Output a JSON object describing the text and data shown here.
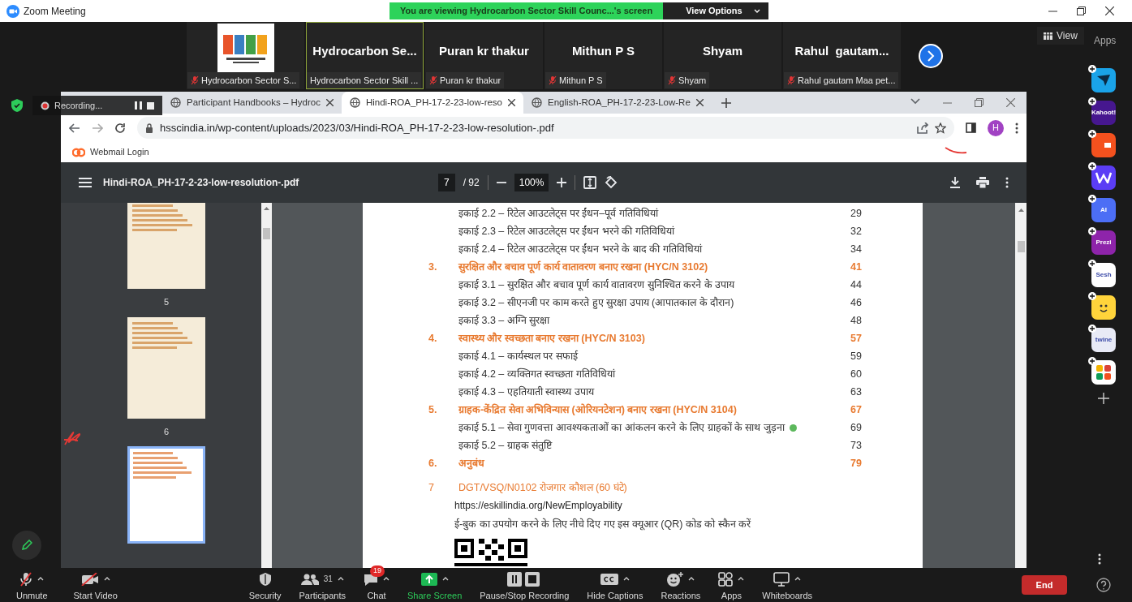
{
  "window": {
    "title": "Zoom Meeting"
  },
  "share_banner": {
    "text": "You are viewing Hydrocarbon Sector Skill Counc...'s screen",
    "view_options": "View Options"
  },
  "participants": [
    {
      "kind": "logo",
      "label": "Hydrocarbon Sector S...",
      "muted": true,
      "speaking": false
    },
    {
      "kind": "name",
      "name": "Hydrocarbon Se...",
      "label": "Hydrocarbon Sector Skill ...",
      "muted": false,
      "speaking": true
    },
    {
      "kind": "name",
      "name": "Puran kr thakur",
      "label": "Puran kr thakur",
      "muted": true,
      "speaking": false
    },
    {
      "kind": "name",
      "name": "Mithun P S",
      "label": "Mithun P S",
      "muted": true,
      "speaking": false
    },
    {
      "kind": "name",
      "name": "Shyam",
      "label": "Shyam",
      "muted": true,
      "speaking": false
    },
    {
      "kind": "name",
      "name": "Rahul  gautam...",
      "label": "Rahul gautam Maa pet...",
      "muted": true,
      "speaking": false
    }
  ],
  "view_button": "View",
  "apps_label": "Apps",
  "apps": [
    {
      "kind": "arrow",
      "color": "#1aa3e8"
    },
    {
      "kind": "text",
      "label": "Kahoot!",
      "color": "#46178f"
    },
    {
      "kind": "shape",
      "color": "#f4511e"
    },
    {
      "kind": "w",
      "color": "#5b3df5"
    },
    {
      "kind": "text",
      "label": "AI",
      "color": "#4c6ef5"
    },
    {
      "kind": "text",
      "label": "Prezi",
      "color": "#8e24aa"
    },
    {
      "kind": "text",
      "label": "Sesh",
      "color": "#ffffff"
    },
    {
      "kind": "face",
      "color": "#ffd43b"
    },
    {
      "kind": "text",
      "label": "twine",
      "color": "#e8eaf6"
    },
    {
      "kind": "grid",
      "color": "#ffffff"
    }
  ],
  "recording": {
    "text": "Recording..."
  },
  "browser": {
    "tabs": [
      {
        "title": "Participant Handbooks – Hydroc",
        "selected": false
      },
      {
        "title": "Hindi-ROA_PH-17-2-23-low-reso",
        "selected": true
      },
      {
        "title": "English-ROA_PH-17-2-23-Low-Re",
        "selected": false
      }
    ],
    "url": "hsscindia.in/wp-content/uploads/2023/03/Hindi-ROA_PH-17-2-23-low-resolution-.pdf",
    "profile_initial": "H",
    "bookmarks": [
      "Webmail Login"
    ]
  },
  "pdf": {
    "filename": "Hindi-ROA_PH-17-2-23-low-resolution-.pdf",
    "page": "7",
    "total": "/ 92",
    "zoom": "100%",
    "thumbnails": [
      {
        "label": "5",
        "selected": false
      },
      {
        "label": "6",
        "selected": false
      },
      {
        "selected": true
      }
    ],
    "toc": [
      {
        "kind": "unit",
        "text": "इकाई 2.2 – रिटेल आउटलेट्स पर ईंधन–पूर्व गतिविधियां",
        "page": "29"
      },
      {
        "kind": "unit",
        "text": "इकाई 2.3 – रिटेल आउटलेट्स पर ईंधन भरने की गतिविधियां",
        "page": "32"
      },
      {
        "kind": "unit",
        "text": "इकाई 2.4 – रिटेल आउटलेट्स पर ईंधन भरने के बाद की गतिविधियां",
        "page": "34"
      },
      {
        "kind": "section",
        "number": "3.",
        "text": "सुरक्षित और बचाव पूर्ण कार्य वातावरण बनाए रखना (HYC/N 3102)",
        "page": "41"
      },
      {
        "kind": "unit",
        "text": "इकाई 3.1 – सुरक्षित और बचाव पूर्ण कार्य वातावरण सुनिश्चित करने के उपाय",
        "page": "44"
      },
      {
        "kind": "unit",
        "text": "इकाई 3.2 – सीएनजी पर काम करते हुए सुरक्षा उपाय (आपातकाल के दौरान)",
        "page": "46"
      },
      {
        "kind": "unit",
        "text": "इकाई 3.3 – अग्नि सुरक्षा",
        "page": "48"
      },
      {
        "kind": "section",
        "number": "4.",
        "text": "स्वास्थ्य और स्वच्छता बनाए रखना (HYC/N 3103)",
        "page": "57"
      },
      {
        "kind": "unit",
        "text": "इकाई 4.1 – कार्यस्थल पर सफाई",
        "page": "59"
      },
      {
        "kind": "unit",
        "text": "इकाई 4.2 – व्यक्तिगत स्वच्छता गतिविधियां",
        "page": "60"
      },
      {
        "kind": "unit",
        "text": "इकाई 4.3 – एहतियाती स्वास्थ्य उपाय",
        "page": "63"
      },
      {
        "kind": "section",
        "number": "5.",
        "text": "ग्राहक-केंद्रित सेवा अभिविन्यास (ओरियनटेशन) बनाए रखना (HYC/N 3104)",
        "page": "67"
      },
      {
        "kind": "unit",
        "text": "इकाई 5.1 – सेवा गुणवत्ता आवश्यकताओं का आंकलन करने के लिए ग्राहकों के साथ जुड़ना",
        "page": "69",
        "annotated": true
      },
      {
        "kind": "unit",
        "text": "इकाई 5.2 – ग्राहक संतुष्टि",
        "page": "73"
      },
      {
        "kind": "section",
        "number": "6.",
        "text": "अनुबंध",
        "page": "79"
      }
    ],
    "footer": {
      "number": "7",
      "heading": "DGT/VSQ/N0102 रोजगार कौशल (60 घंटे)",
      "link": "https://eskillindia.org/NewEmployability",
      "instruction": "ई-बुक का उपयोग करने के लिए नीचे दिए गए इस क्यूआर (QR) कोड को स्कैन करें"
    }
  },
  "toolbar": {
    "left": [
      {
        "kind": "mic",
        "label": "Unmute",
        "caret": true
      },
      {
        "kind": "video",
        "label": "Start Video",
        "caret": true
      }
    ],
    "center": [
      {
        "kind": "security",
        "label": "Security",
        "caret": false
      },
      {
        "kind": "participants",
        "label": "Participants",
        "count": "31",
        "caret": true
      },
      {
        "kind": "chat",
        "label": "Chat",
        "badge": "19",
        "caret": true
      },
      {
        "kind": "share",
        "label": "Share Screen",
        "caret": true
      },
      {
        "kind": "record",
        "label": "Pause/Stop Recording",
        "caret": false
      },
      {
        "kind": "captions",
        "label": "Hide Captions",
        "caret": true
      },
      {
        "kind": "reactions",
        "label": "Reactions",
        "caret": true
      },
      {
        "kind": "apps",
        "label": "Apps",
        "caret": true
      },
      {
        "kind": "whiteboard",
        "label": "Whiteboards",
        "caret": true
      }
    ],
    "end": "End"
  }
}
